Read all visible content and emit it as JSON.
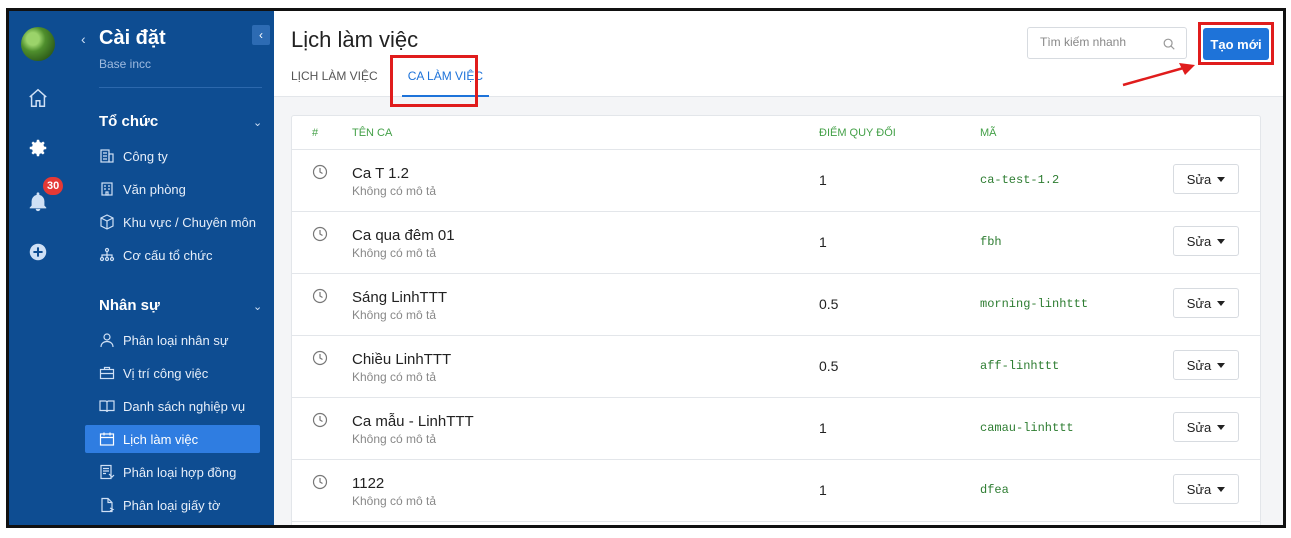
{
  "rail": {
    "notification_count": "30"
  },
  "sidebar": {
    "title": "Cài đặt",
    "subtitle": "Base incc",
    "collapse_icon": "chevron-left-icon",
    "groups": [
      {
        "label": "Tổ chức",
        "items": [
          {
            "label": "Công ty",
            "icon": "building-icon"
          },
          {
            "label": "Văn phòng",
            "icon": "office-icon"
          },
          {
            "label": "Khu vực / Chuyên môn",
            "icon": "cube-icon"
          },
          {
            "label": "Cơ cấu tổ chức",
            "icon": "org-chart-icon"
          }
        ]
      },
      {
        "label": "Nhân sự",
        "items": [
          {
            "label": "Phân loại nhân sự",
            "icon": "user-icon"
          },
          {
            "label": "Vị trí công việc",
            "icon": "briefcase-icon"
          },
          {
            "label": "Danh sách nghiệp vụ",
            "icon": "book-icon"
          },
          {
            "label": "Lịch làm việc",
            "icon": "calendar-icon",
            "active": true
          },
          {
            "label": "Phân loại hợp đồng",
            "icon": "contract-icon"
          },
          {
            "label": "Phân loại giấy tờ",
            "icon": "document-icon"
          }
        ]
      }
    ]
  },
  "header": {
    "title": "Lịch làm việc",
    "tabs": [
      {
        "label": "LỊCH LÀM VIỆC",
        "active": false
      },
      {
        "label": "CA LÀM VIỆC",
        "active": true
      }
    ],
    "search_placeholder": "Tìm kiếm nhanh",
    "create_label": "Tạo mới"
  },
  "table": {
    "columns": {
      "index": "#",
      "name": "TÊN CA",
      "score": "ĐIỂM QUY ĐỔI",
      "code": "MÃ"
    },
    "edit_label": "Sửa",
    "rows": [
      {
        "name": "Ca T 1.2",
        "desc": "Không có mô tả",
        "score": "1",
        "code": "ca-test-1.2"
      },
      {
        "name": "Ca qua đêm 01",
        "desc": "Không có mô tả",
        "score": "1",
        "code": "fbh"
      },
      {
        "name": "Sáng LinhTTT",
        "desc": "Không có mô tả",
        "score": "0.5",
        "code": "morning-linhttt"
      },
      {
        "name": "Chiều LinhTTT",
        "desc": "Không có mô tả",
        "score": "0.5",
        "code": "aff-linhttt"
      },
      {
        "name": "Ca mẫu - LinhTTT",
        "desc": "Không có mô tả",
        "score": "1",
        "code": "camau-linhttt"
      },
      {
        "name": "1122",
        "desc": "Không có mô tả",
        "score": "1",
        "code": "dfea"
      }
    ]
  },
  "colors": {
    "sidebar": "#0e4d92",
    "accent": "#1e73d9",
    "highlight": "#e01c1c",
    "code": "#2e7d32"
  }
}
